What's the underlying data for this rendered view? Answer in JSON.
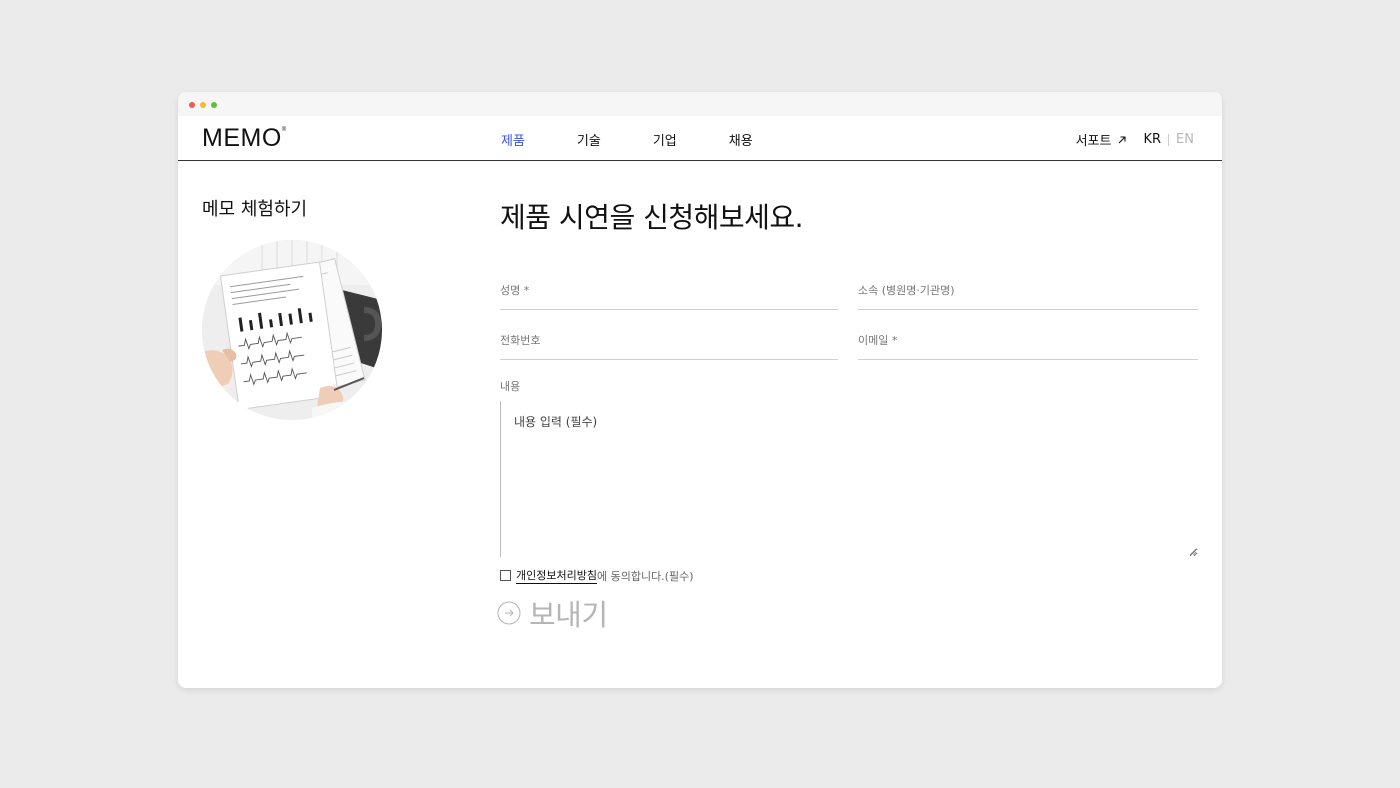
{
  "brand": {
    "logo": "MEMO",
    "logo_mark": "®"
  },
  "nav": {
    "items": [
      {
        "label": "제품",
        "active": true
      },
      {
        "label": "기술",
        "active": false
      },
      {
        "label": "기업",
        "active": false
      },
      {
        "label": "채용",
        "active": false
      }
    ],
    "support_label": "서포트",
    "lang_kr": "KR",
    "lang_en": "EN"
  },
  "sidebar": {
    "title": "메모 체험하기",
    "image": "doctor-holding-ecg-report"
  },
  "form": {
    "heading": "제품 시연을 신청해보세요.",
    "fields": {
      "name": "성명 *",
      "affiliation": "소속 (병원명·기관명)",
      "phone": "전화번호",
      "email": "이메일 *"
    },
    "content_label": "내용",
    "content_placeholder": "내용 입력 (필수)",
    "consent_link": "개인정보처리방침",
    "consent_text": "에 동의합니다.(필수)",
    "submit_label": "보내기"
  },
  "colors": {
    "accent": "#3b56d9",
    "disabled": "#b5b5b5"
  }
}
